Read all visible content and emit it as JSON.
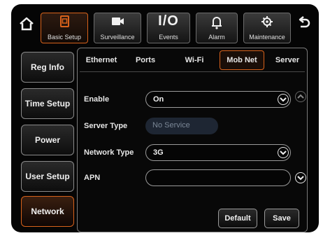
{
  "top_tabs": [
    {
      "label": "Basic Setup",
      "icon": "document-icon"
    },
    {
      "label": "Surveillance",
      "icon": "camera-icon"
    },
    {
      "label": "Events",
      "icon": "io-icon",
      "icon_text": "I/O"
    },
    {
      "label": "Alarm",
      "icon": "bell-icon"
    },
    {
      "label": "Maintenance",
      "icon": "settings-icon"
    }
  ],
  "left_nav": [
    {
      "label": "Reg Info"
    },
    {
      "label": "Time Setup"
    },
    {
      "label": "Power"
    },
    {
      "label": "User Setup"
    },
    {
      "label": "Network"
    }
  ],
  "sub_tabs": [
    {
      "label": "Ethernet"
    },
    {
      "label": "Ports"
    },
    {
      "label": "Wi-Fi"
    },
    {
      "label": "Mob Net"
    },
    {
      "label": "Server"
    }
  ],
  "form": {
    "enable_label": "Enable",
    "enable_value": "On",
    "server_type_label": "Server Type",
    "server_type_value": "No Service",
    "network_type_label": "Network Type",
    "network_type_value": "3G",
    "apn_label": "APN",
    "apn_value": ""
  },
  "buttons": {
    "default": "Default",
    "save": "Save"
  },
  "colors": {
    "accent": "#d8621b",
    "background": "#050505",
    "text": "#e8e8e8"
  }
}
